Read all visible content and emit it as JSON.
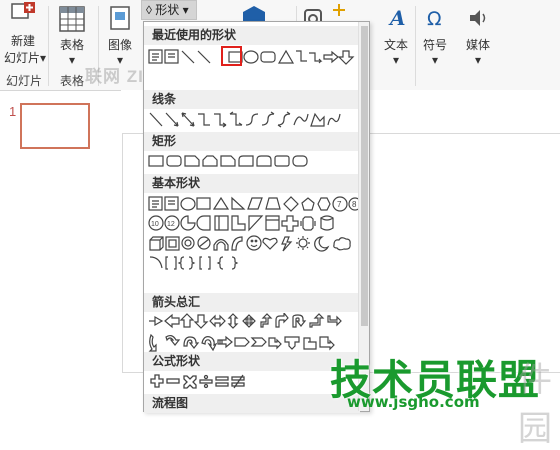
{
  "ribbon": {
    "new_slide_line1": "新建",
    "new_slide_line2": "幻灯片",
    "table_label": "表格",
    "image_label": "图像",
    "shape_label": "形状",
    "shape_caret": "▾",
    "text_label": "文本",
    "symbol_label": "符号",
    "media_label": "媒体",
    "caret": "▾",
    "group_slides": "幻灯片",
    "group_tables": "表格"
  },
  "slide_panel": {
    "slide_number": "1"
  },
  "shapes_dropdown": {
    "sections": {
      "recent": "最近使用的形状",
      "lines": "线条",
      "rectangles": "矩形",
      "basic": "基本形状",
      "arrows": "箭头总汇",
      "equation": "公式形状",
      "flowchart": "流程图"
    },
    "selected_shape": "rectangle"
  },
  "watermark": {
    "top": "联网  ZIXUE.COM",
    "site_name": "技术员联盟",
    "site_url": "www.jsgho.com",
    "tail": "件园"
  },
  "colors": {
    "selection_border": "#e0201b",
    "slide_border": "#d0745a",
    "watermark_green": "#1a9a2e"
  }
}
